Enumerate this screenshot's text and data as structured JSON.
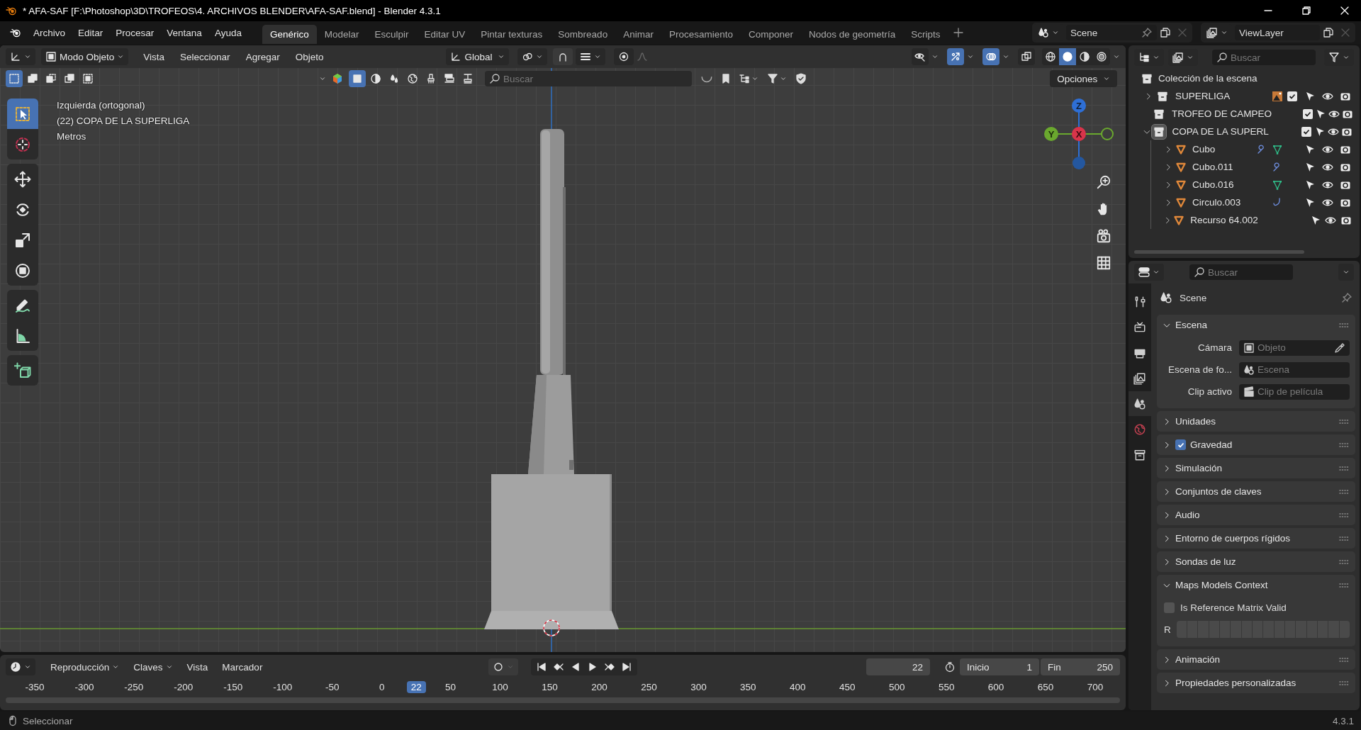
{
  "window": {
    "title": "* AFA-SAF [F:\\Photoshop\\3D\\TROFEOS\\4. ARCHIVOS BLENDER\\AFA-SAF.blend] - Blender 4.3.1"
  },
  "menu": [
    "Archivo",
    "Editar",
    "Procesar",
    "Ventana",
    "Ayuda"
  ],
  "workspaces": [
    {
      "label": "Genérico",
      "selected": true
    },
    {
      "label": "Modelar",
      "selected": false
    },
    {
      "label": "Esculpir",
      "selected": false
    },
    {
      "label": "Editar UV",
      "selected": false
    },
    {
      "label": "Pintar texturas",
      "selected": false
    },
    {
      "label": "Sombreado",
      "selected": false
    },
    {
      "label": "Animar",
      "selected": false
    },
    {
      "label": "Procesamiento",
      "selected": false
    },
    {
      "label": "Componer",
      "selected": false
    },
    {
      "label": "Nodos de geometría",
      "selected": false
    },
    {
      "label": "Scripts",
      "selected": false
    }
  ],
  "scene": "Scene",
  "view_layer": "ViewLayer",
  "viewport": {
    "mode": "Modo Objeto",
    "menus": [
      "Vista",
      "Seleccionar",
      "Agregar",
      "Objeto"
    ],
    "orientation": "Global",
    "toggles": [
      {
        "kind": "visibility",
        "on": false
      },
      {
        "kind": "gizmos",
        "on": true
      },
      {
        "kind": "overlays",
        "on": true
      },
      {
        "kind": "xray",
        "on": false
      }
    ],
    "shading": [
      {
        "kind": "wireframe",
        "selected": false
      },
      {
        "kind": "solid",
        "selected": true
      },
      {
        "kind": "material",
        "selected": false
      },
      {
        "kind": "rendered",
        "selected": false
      }
    ],
    "select_modes": [
      {
        "kind": "set",
        "selected": true
      },
      {
        "kind": "extend",
        "selected": false
      },
      {
        "kind": "subtract",
        "selected": false
      },
      {
        "kind": "invert",
        "selected": false
      },
      {
        "kind": "intersect",
        "selected": false
      }
    ],
    "shelf_filters": [
      {
        "kind": "object",
        "selected": true
      },
      {
        "kind": "material",
        "selected": false
      },
      {
        "kind": "particles",
        "selected": false
      },
      {
        "kind": "world",
        "selected": false
      },
      {
        "kind": "brush",
        "selected": false
      },
      {
        "kind": "layers",
        "selected": false
      },
      {
        "kind": "stamp",
        "selected": false
      }
    ],
    "shelf_search": {
      "placeholder": "Buscar"
    },
    "options": "Opciones",
    "info": [
      "Izquierda (ortogonal)",
      "(22) COPA DE LA SUPERLIGA",
      "Metros"
    ],
    "tools": [
      [
        {
          "kind": "select",
          "selected": true
        },
        {
          "kind": "cursor",
          "selected": false
        }
      ],
      [
        {
          "kind": "move",
          "selected": false
        },
        {
          "kind": "rotate",
          "selected": false
        },
        {
          "kind": "scale",
          "selected": false
        },
        {
          "kind": "transform",
          "selected": false
        }
      ],
      [
        {
          "kind": "annotate",
          "selected": false
        },
        {
          "kind": "measure",
          "selected": false
        }
      ],
      [
        {
          "kind": "add_cube",
          "selected": false
        }
      ]
    ],
    "axes": [
      "Z",
      "Y",
      "X"
    ]
  },
  "outliner": {
    "search": {
      "placeholder": "Buscar"
    },
    "root": "Colección de la escena",
    "items": [
      {
        "name": "SUPERLIGA",
        "kind": "collection",
        "expandable": true,
        "expanded": false,
        "active": false,
        "checked": true,
        "extras": [
          {
            "kind": "image"
          }
        ]
      },
      {
        "name": "TROFEO DE CAMPEO",
        "kind": "collection",
        "expandable": false,
        "active": false,
        "checked": true
      },
      {
        "name": "COPA DE LA SUPERL",
        "kind": "collection",
        "expandable": true,
        "expanded": true,
        "active": true,
        "checked": true,
        "children": [
          {
            "name": "Cubo",
            "kind": "mesh",
            "expanded": false,
            "extras": [
              {
                "kind": "modifier"
              },
              {
                "kind": "mesh"
              }
            ]
          },
          {
            "name": "Cubo.011",
            "kind": "mesh",
            "expanded": false,
            "extras": [
              {
                "kind": "modifier"
              }
            ]
          },
          {
            "name": "Cubo.016",
            "kind": "mesh",
            "expanded": false,
            "extras": [
              {
                "kind": "mesh"
              }
            ]
          },
          {
            "name": "Circulo.003",
            "kind": "mesh",
            "expanded": false,
            "extras": [
              {
                "kind": "hook"
              }
            ]
          },
          {
            "name": "Recurso 64.002",
            "kind": "mesh",
            "expanded": false
          }
        ]
      }
    ]
  },
  "properties": {
    "search": {
      "placeholder": "Buscar"
    },
    "tabs": [
      {
        "kind": "tool",
        "selected": false
      },
      {
        "kind": "render",
        "selected": false
      },
      {
        "kind": "output",
        "selected": false
      },
      {
        "kind": "view_layer",
        "selected": false
      },
      {
        "kind": "scene",
        "selected": true
      },
      {
        "kind": "world",
        "selected": false
      },
      {
        "kind": "collection",
        "selected": false
      }
    ],
    "context": "Scene",
    "panels": [
      {
        "title": "Escena",
        "expanded": true,
        "fields": [
          {
            "label": "Cámara",
            "placeholder": "Objeto",
            "kind": "object"
          },
          {
            "label": "Escena de fo...",
            "placeholder": "Escena",
            "kind": "scene"
          },
          {
            "label": "Clip activo",
            "placeholder": "Clip de película",
            "kind": "clip"
          }
        ]
      },
      {
        "title": "Unidades",
        "expanded": false
      },
      {
        "title": "Gravedad",
        "expanded": false,
        "checked": true
      },
      {
        "title": "Simulación",
        "expanded": false
      },
      {
        "title": "Conjuntos de claves",
        "expanded": false
      },
      {
        "title": "Audio",
        "expanded": false
      },
      {
        "title": "Entorno de cuerpos rígidos",
        "expanded": false
      },
      {
        "title": "Sondas de luz",
        "expanded": false
      },
      {
        "title": "Maps Models Context",
        "expanded": true,
        "options": [
          {
            "label": "Is Reference Matrix Valid",
            "checked": false
          }
        ],
        "matrix_label": "R"
      },
      {
        "title": "Animación",
        "expanded": false
      },
      {
        "title": "Propiedades personalizadas",
        "expanded": false
      }
    ]
  },
  "timeline": {
    "menus": [
      {
        "label": "Reproducción",
        "kind": "popover"
      },
      {
        "label": "Claves",
        "kind": "popover"
      },
      {
        "label": "Vista",
        "kind": "menu"
      },
      {
        "label": "Marcador",
        "kind": "menu"
      }
    ],
    "auto_keying": false,
    "current_frame": "22",
    "start_label": "Inicio",
    "start": "1",
    "end_label": "Fin",
    "end": "250",
    "ticks": [
      {
        "label": "-350",
        "selected": false
      },
      {
        "label": "-300",
        "selected": false
      },
      {
        "label": "-250",
        "selected": false
      },
      {
        "label": "-200",
        "selected": false
      },
      {
        "label": "-150",
        "selected": false
      },
      {
        "label": "-100",
        "selected": false
      },
      {
        "label": "-50",
        "selected": false
      },
      {
        "label": "0",
        "selected": false
      },
      {
        "label": "22",
        "selected": true
      },
      {
        "label": "50",
        "selected": false
      },
      {
        "label": "100",
        "selected": false
      },
      {
        "label": "150",
        "selected": false
      },
      {
        "label": "200",
        "selected": false
      },
      {
        "label": "250",
        "selected": false
      },
      {
        "label": "300",
        "selected": false
      },
      {
        "label": "350",
        "selected": false
      },
      {
        "label": "400",
        "selected": false
      },
      {
        "label": "450",
        "selected": false
      },
      {
        "label": "500",
        "selected": false
      },
      {
        "label": "550",
        "selected": false
      },
      {
        "label": "600",
        "selected": false
      },
      {
        "label": "650",
        "selected": false
      },
      {
        "label": "700",
        "selected": false
      }
    ]
  },
  "status": {
    "hint": "Seleccionar",
    "version": "4.3.1"
  }
}
